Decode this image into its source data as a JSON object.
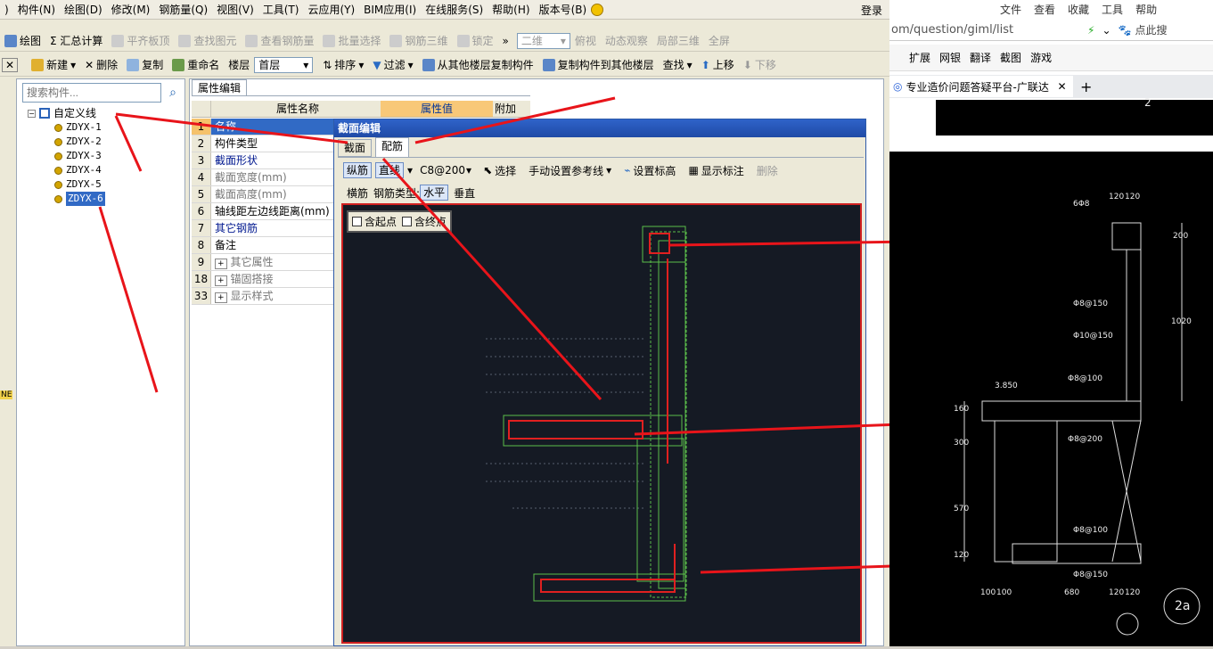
{
  "menu": [
    "构件(N)",
    "绘图(D)",
    "修改(M)",
    "钢筋量(Q)",
    "视图(V)",
    "工具(T)",
    "云应用(Y)",
    "BIM应用(I)",
    "在线服务(S)",
    "帮助(H)",
    "版本号(B)"
  ],
  "login": "登录",
  "toolbar1": {
    "items": [
      "绘图",
      "Σ 汇总计算",
      "平齐板顶",
      "查找图元",
      "查看钢筋量",
      "批量选择",
      "钢筋三维",
      "锁定"
    ],
    "view_combo": "二维",
    "items2": [
      "俯视",
      "动态观察",
      "局部三维",
      "全屏"
    ]
  },
  "toolbar2": {
    "new": "新建",
    "delete": "删除",
    "copy": "复制",
    "rename": "重命名",
    "floor_label": "楼层",
    "floor_value": "首层",
    "sort": "排序",
    "filter": "过滤",
    "copy_from": "从其他楼层复制构件",
    "copy_to": "复制构件到其他楼层",
    "find": "查找",
    "up": "上移",
    "down": "下移"
  },
  "left": {
    "search_placeholder": "搜索构件...",
    "tree_root": "自定义线",
    "items": [
      "ZDYX-1",
      "ZDYX-2",
      "ZDYX-3",
      "ZDYX-4",
      "ZDYX-5",
      "ZDYX-6"
    ],
    "side_label": "NE"
  },
  "props": {
    "tab": "属性编辑",
    "col_name": "属性名称",
    "col_value": "属性值",
    "col_extra": "附加",
    "rows": [
      {
        "n": "1",
        "k": "名称"
      },
      {
        "n": "2",
        "k": "构件类型"
      },
      {
        "n": "3",
        "k": "截面形状"
      },
      {
        "n": "4",
        "k": "截面宽度(mm)"
      },
      {
        "n": "5",
        "k": "截面高度(mm)"
      },
      {
        "n": "6",
        "k": "轴线距左边线距离(mm)"
      },
      {
        "n": "7",
        "k": "其它钢筋"
      },
      {
        "n": "8",
        "k": "备注"
      },
      {
        "n": "9",
        "k": "其它属性"
      },
      {
        "n": "18",
        "k": "锚固搭接"
      },
      {
        "n": "33",
        "k": "显示样式"
      }
    ]
  },
  "dialog": {
    "title": "截面编辑",
    "tab1": "截面",
    "tab2": "配筋",
    "longbar": "纵筋",
    "straight": "直线",
    "spec": "C8@200",
    "select": "选择",
    "manual_ref": "手动设置参考线",
    "set_elev": "设置标高",
    "show_dim": "显示标注",
    "del": "删除",
    "transverse": "横筋",
    "bar_type_label": "钢筋类型:",
    "horizontal": "水平",
    "vertical": "垂直",
    "with_start": "含起点",
    "with_end": "含终点"
  },
  "browser": {
    "menu": [
      "文件",
      "查看",
      "收藏",
      "工具",
      "帮助"
    ],
    "url": "om/question/giml/list",
    "search_hint": "点此搜",
    "fav": [
      "扩展",
      "网银",
      "翻译",
      "截图",
      "游戏"
    ],
    "tab": "专业造价问题答疑平台-广联达",
    "cad": {
      "dims": [
        "120",
        "120",
        "200",
        "6Φ8",
        "1020",
        "Φ8@150",
        "Φ10@150",
        "Φ8@100",
        "3.850",
        "Φ8@200",
        "Φ8@100",
        "Φ8@150",
        "160",
        "300",
        "570",
        "120",
        "100",
        "100",
        "680",
        "120",
        "120",
        "2",
        "2a"
      ]
    }
  }
}
